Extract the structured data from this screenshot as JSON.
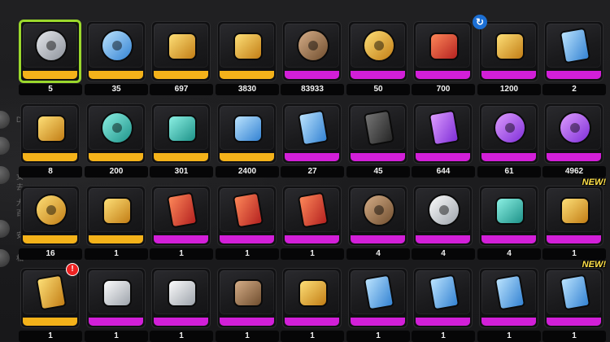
{
  "side": {
    "labels": [
      "Der",
      "女去",
      "大百",
      "安",
      "相"
    ]
  },
  "inventory": {
    "rows": [
      [
        {
          "name": "film-reel-silver-icon",
          "count": "5",
          "rarity": "gold",
          "selected": true
        },
        {
          "name": "film-reel-blue-icon",
          "count": "35",
          "rarity": "gold"
        },
        {
          "name": "rabbit-device-icon",
          "count": "697",
          "rarity": "gold"
        },
        {
          "name": "gold-cube-icon",
          "count": "3830",
          "rarity": "gold"
        },
        {
          "name": "bronze-coin-icon",
          "count": "83933",
          "rarity": "pink"
        },
        {
          "name": "gold-coin-icon",
          "count": "50",
          "rarity": "pink"
        },
        {
          "name": "crystal-cluster-icon",
          "count": "700",
          "rarity": "pink"
        },
        {
          "name": "golden-fish-icon",
          "count": "1200",
          "rarity": "pink",
          "mark": "↻"
        },
        {
          "name": "blue-book-icon",
          "count": "2",
          "rarity": "pink"
        }
      ],
      [
        {
          "name": "gold-puzzle-box-icon",
          "count": "8",
          "rarity": "gold"
        },
        {
          "name": "teal-gear-icon",
          "count": "200",
          "rarity": "gold"
        },
        {
          "name": "teal-dice-icon",
          "count": "301",
          "rarity": "gold"
        },
        {
          "name": "blue-chest-icon",
          "count": "2400",
          "rarity": "gold"
        },
        {
          "name": "blue-card-icon",
          "count": "27",
          "rarity": "pink"
        },
        {
          "name": "black-card-icon",
          "count": "45",
          "rarity": "pink"
        },
        {
          "name": "purple-card-icon",
          "count": "644",
          "rarity": "pink"
        },
        {
          "name": "purple-disc-icon",
          "count": "61",
          "rarity": "pink"
        },
        {
          "name": "purple-gear-icon",
          "count": "4962",
          "rarity": "pink"
        }
      ],
      [
        {
          "name": "hia-gold-coin-icon",
          "count": "16",
          "rarity": "gold"
        },
        {
          "name": "gold-figure-icon",
          "count": "1",
          "rarity": "gold"
        },
        {
          "name": "red-ticket-icon",
          "count": "1",
          "rarity": "pink"
        },
        {
          "name": "red-ticket-icon",
          "count": "1",
          "rarity": "pink"
        },
        {
          "name": "red-ticket-icon",
          "count": "1",
          "rarity": "pink"
        },
        {
          "name": "bronze-wheel-icon",
          "count": "4",
          "rarity": "pink"
        },
        {
          "name": "film-reel-gold-icon",
          "count": "4",
          "rarity": "pink"
        },
        {
          "name": "teal-hammer-icon",
          "count": "4",
          "rarity": "pink"
        },
        {
          "name": "gold-carrot-icon",
          "count": "1",
          "rarity": "pink",
          "new": "NEW!"
        }
      ],
      [
        {
          "name": "w-engine-card-icon",
          "count": "1",
          "rarity": "gold",
          "alert": "!"
        },
        {
          "name": "cat-stickers-icon",
          "count": "1",
          "rarity": "pink"
        },
        {
          "name": "cat-stickers-icon",
          "count": "1",
          "rarity": "pink"
        },
        {
          "name": "tiger-cat-box-icon",
          "count": "1",
          "rarity": "pink"
        },
        {
          "name": "tiger-cat-box-gold-icon",
          "count": "1",
          "rarity": "pink"
        },
        {
          "name": "blue-flower-card-icon",
          "count": "1",
          "rarity": "pink"
        },
        {
          "name": "blue-flower-card-icon",
          "count": "1",
          "rarity": "pink"
        },
        {
          "name": "blue-flower-card-icon",
          "count": "1",
          "rarity": "pink"
        },
        {
          "name": "blue-flower-card-icon",
          "count": "1",
          "rarity": "pink",
          "new": "NEW!"
        }
      ]
    ]
  },
  "colors": {
    "gold": "#f4b21a",
    "pink": "#d21fd8",
    "select": "#9bd82c"
  }
}
